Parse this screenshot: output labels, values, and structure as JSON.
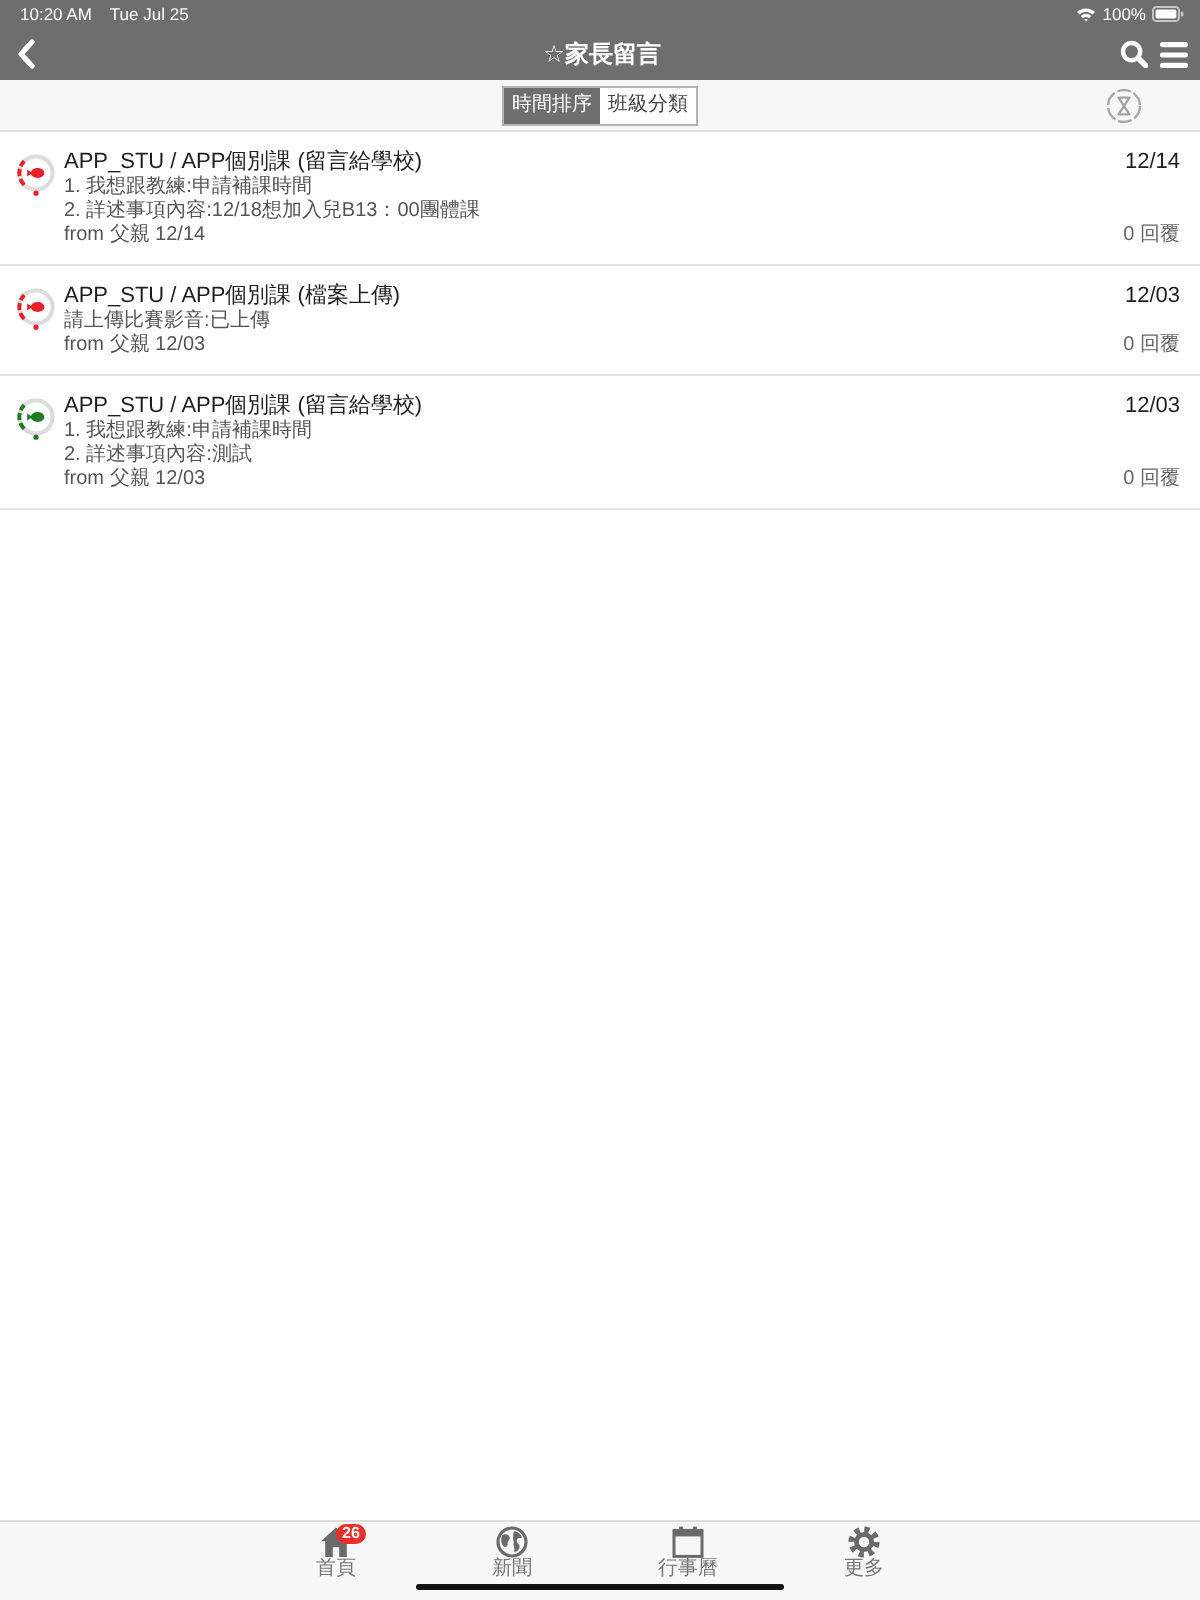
{
  "status_bar": {
    "time": "10:20 AM",
    "date": "Tue Jul 25",
    "battery": "100%"
  },
  "nav_bar": {
    "title": "☆家長留言"
  },
  "segments": [
    {
      "label": "時間排序",
      "selected": true
    },
    {
      "label": "班級分類",
      "selected": false
    }
  ],
  "messages": [
    {
      "color": "#e8202a",
      "title": "APP_STU / APP個別課 (留言給學校)",
      "lines": [
        "1. 我想跟教練:申請補課時間",
        "2. 詳述事項內容:12/18想加入兒B13：00團體課"
      ],
      "from": "from 父親 12/14",
      "date": "12/14",
      "replies": "0 回覆"
    },
    {
      "color": "#e8202a",
      "title": "APP_STU / APP個別課 (檔案上傳)",
      "lines": [
        "請上傳比賽影音:已上傳"
      ],
      "from": "from 父親 12/03",
      "date": "12/03",
      "replies": "0 回覆"
    },
    {
      "color": "#1f7a24",
      "title": "APP_STU / APP個別課 (留言給學校)",
      "lines": [
        "1. 我想跟教練:申請補課時間",
        "2. 詳述事項內容:測試"
      ],
      "from": "from 父親 12/03",
      "date": "12/03",
      "replies": "0 回覆"
    }
  ],
  "tab_bar": {
    "items": [
      {
        "label": "首頁",
        "badge": "26"
      },
      {
        "label": "新聞"
      },
      {
        "label": "行事曆"
      },
      {
        "label": "更多"
      }
    ]
  }
}
